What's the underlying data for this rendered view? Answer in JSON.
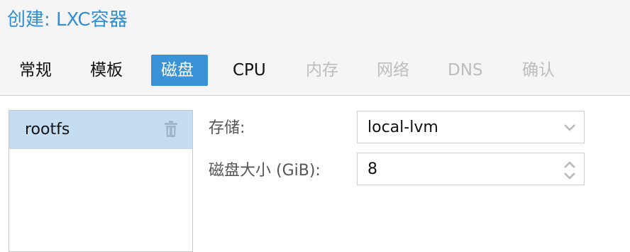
{
  "dialog": {
    "title": "创建: LXC容器"
  },
  "tabs": [
    {
      "label": "常规",
      "state": "enabled"
    },
    {
      "label": "模板",
      "state": "enabled"
    },
    {
      "label": "磁盘",
      "state": "active"
    },
    {
      "label": "CPU",
      "state": "enabled"
    },
    {
      "label": "内存",
      "state": "disabled"
    },
    {
      "label": "网络",
      "state": "disabled"
    },
    {
      "label": "DNS",
      "state": "disabled"
    },
    {
      "label": "确认",
      "state": "disabled"
    }
  ],
  "disks": {
    "items": [
      {
        "label": "rootfs",
        "icon": "trash-icon"
      }
    ]
  },
  "fields": {
    "storage": {
      "label": "存储:",
      "value": "local-lvm",
      "icon": "chevron-down-icon"
    },
    "disk_size": {
      "label": "磁盘大小 (GiB):",
      "value": "8",
      "icon": "spinner-icon"
    }
  },
  "colors": {
    "accent": "#3a93d7",
    "title": "#2f8fd6",
    "selected_row": "#c4ddf1",
    "disabled_text": "#bdbdbd"
  }
}
